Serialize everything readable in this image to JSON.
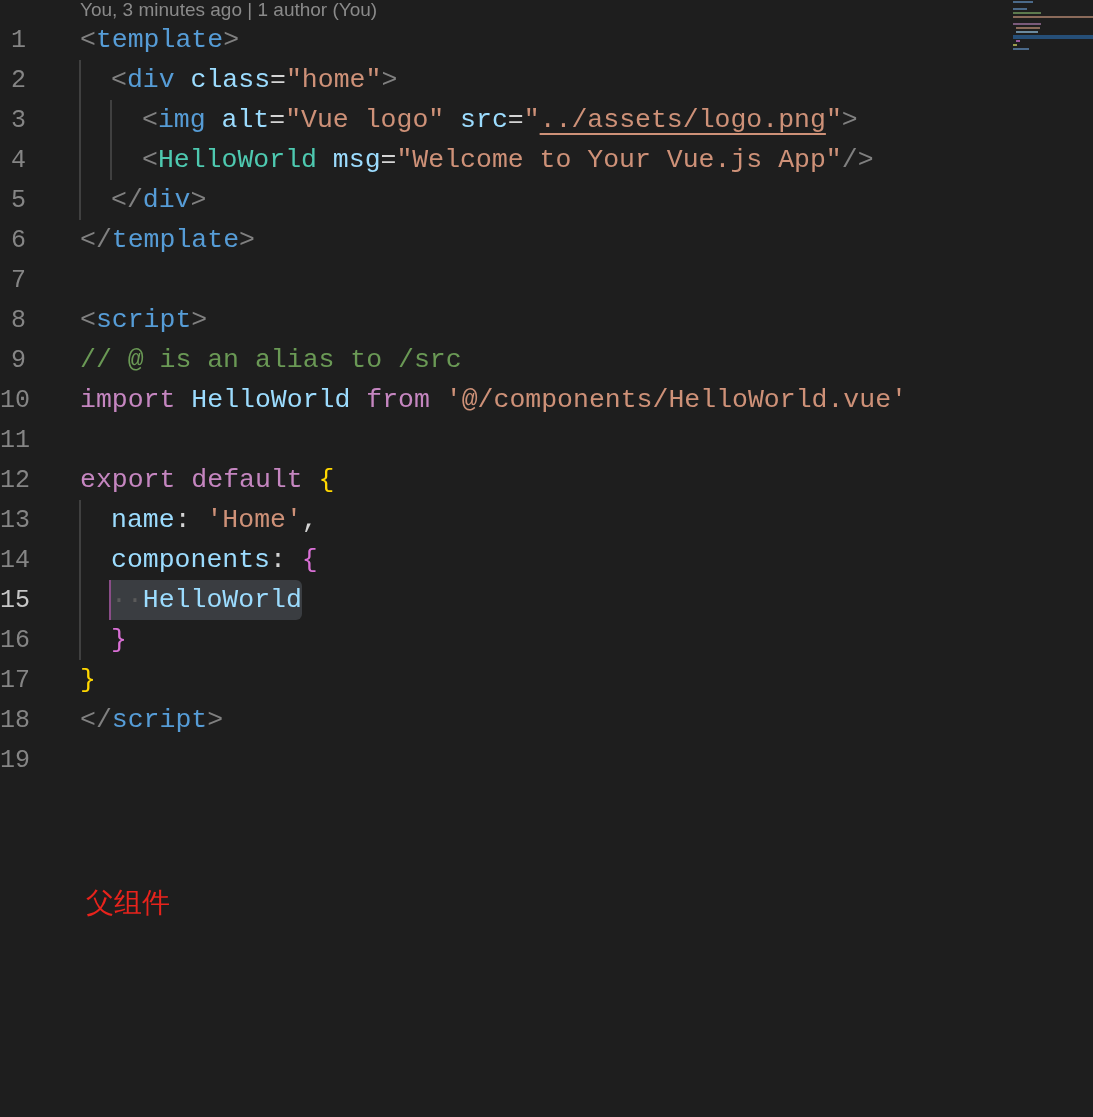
{
  "blame": "You, 3 minutes ago | 1 author (You)",
  "lines": [
    {
      "number": "1",
      "current": false,
      "tokens": [
        {
          "kind": "punct",
          "text": "<"
        },
        {
          "kind": "tag",
          "text": "template"
        },
        {
          "kind": "punct",
          "text": ">"
        }
      ],
      "children": [
        {
          "number": "2",
          "current": false,
          "tokens": [
            {
              "kind": "punct",
              "text": "<"
            },
            {
              "kind": "tag",
              "text": "div "
            },
            {
              "kind": "attr",
              "text": "class"
            },
            {
              "kind": "plain",
              "text": "="
            },
            {
              "kind": "string",
              "text": "\"home\""
            },
            {
              "kind": "punct",
              "text": ">"
            }
          ],
          "children": [
            {
              "number": "3",
              "current": false,
              "tokens": [
                {
                  "kind": "punct",
                  "text": "<"
                },
                {
                  "kind": "tag",
                  "text": "img "
                },
                {
                  "kind": "attr",
                  "text": "alt"
                },
                {
                  "kind": "plain",
                  "text": "="
                },
                {
                  "kind": "string",
                  "text": "\"Vue logo\" "
                },
                {
                  "kind": "attr",
                  "text": "src"
                },
                {
                  "kind": "plain",
                  "text": "="
                },
                {
                  "kind": "string",
                  "text": "\""
                },
                {
                  "kind": "link",
                  "text": "../assets/logo.png"
                },
                {
                  "kind": "string",
                  "text": "\""
                },
                {
                  "kind": "punct",
                  "text": ">"
                }
              ]
            },
            {
              "number": "4",
              "current": false,
              "tokens": [
                {
                  "kind": "punct",
                  "text": "<"
                },
                {
                  "kind": "component",
                  "text": "HelloWorld "
                },
                {
                  "kind": "attr",
                  "text": "msg"
                },
                {
                  "kind": "plain",
                  "text": "="
                },
                {
                  "kind": "string",
                  "text": "\"Welcome to Your Vue.js App\""
                },
                {
                  "kind": "punct",
                  "text": "/>"
                }
              ]
            }
          ]
        },
        {
          "number": "5",
          "current": false,
          "tokens": [
            {
              "kind": "punct",
              "text": "</"
            },
            {
              "kind": "tag",
              "text": "div"
            },
            {
              "kind": "punct",
              "text": ">"
            }
          ]
        }
      ]
    },
    {
      "number": "6",
      "current": false,
      "tokens": [
        {
          "kind": "punct",
          "text": "</"
        },
        {
          "kind": "tag",
          "text": "template"
        },
        {
          "kind": "punct",
          "text": ">"
        }
      ]
    },
    {
      "number": "7",
      "current": false
    },
    {
      "number": "8",
      "current": false,
      "tokens": [
        {
          "kind": "punct",
          "text": "<"
        },
        {
          "kind": "tag",
          "text": "script"
        },
        {
          "kind": "punct",
          "text": ">"
        }
      ]
    },
    {
      "number": "9",
      "current": false,
      "tokens": [
        {
          "kind": "comment",
          "text": "// @ is an alias to /src"
        }
      ]
    },
    {
      "number": "10",
      "current": false,
      "tokens": [
        {
          "kind": "keyword",
          "text": "import "
        },
        {
          "kind": "attr",
          "text": "HelloWorld "
        },
        {
          "kind": "keyword",
          "text": "from "
        },
        {
          "kind": "string",
          "text": "'@/components/HelloWorld.vue'"
        }
      ]
    },
    {
      "number": "11",
      "current": false
    },
    {
      "number": "12",
      "current": false,
      "tokens": [
        {
          "kind": "keyword",
          "text": "export "
        },
        {
          "kind": "keyword",
          "text": "default "
        },
        {
          "kind": "brace1",
          "text": "{"
        }
      ],
      "children": [
        {
          "number": "13",
          "current": false,
          "tokens": [
            {
              "kind": "attr",
              "text": "name"
            },
            {
              "kind": "plain",
              "text": ": "
            },
            {
              "kind": "string",
              "text": "'Home'"
            },
            {
              "kind": "plain",
              "text": ","
            }
          ]
        },
        {
          "number": "14",
          "current": false,
          "tokens": [
            {
              "kind": "attr",
              "text": "components"
            },
            {
              "kind": "plain",
              "text": ": "
            },
            {
              "kind": "brace2",
              "text": "{"
            }
          ]
        },
        {
          "number": "15",
          "current": true,
          "tokens": [
            {
              "kind": "whitespace",
              "text": "··"
            },
            {
              "kind": "selection",
              "text": "HelloWorld"
            }
          ]
        },
        {
          "number": "16",
          "current": false,
          "tokens": [
            {
              "kind": "brace2",
              "text": "}"
            }
          ]
        }
      ]
    },
    {
      "number": "17",
      "current": false,
      "tokens": [
        {
          "kind": "brace1",
          "text": "}"
        }
      ]
    },
    {
      "number": "18",
      "current": false,
      "tokens": [
        {
          "kind": "punct",
          "text": "</"
        },
        {
          "kind": "tag",
          "text": "script"
        },
        {
          "kind": "punct",
          "text": ">"
        }
      ]
    },
    {
      "number": "19",
      "current": false
    }
  ],
  "annotation": "父组件"
}
